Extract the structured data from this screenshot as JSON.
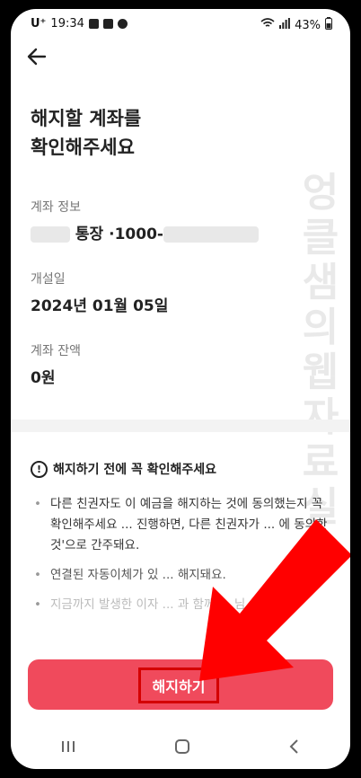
{
  "status_bar": {
    "carrier": "U⁺",
    "time": "19:34",
    "battery": "43%"
  },
  "header": {
    "back_icon": "arrow-left-icon"
  },
  "page": {
    "title_line1": "해지할 계좌를",
    "title_line2": "확인해주세요"
  },
  "account": {
    "info_label": "계좌 정보",
    "account_type": "통장",
    "account_number_prefix": "·1000-",
    "opened_label": "개설일",
    "opened_value": "2024년 01월 05일",
    "balance_label": "계좌 잔액",
    "balance_value": "0원"
  },
  "notice": {
    "title": "해지하기 전에 꼭 확인해주세요",
    "items": [
      "다른 친권자도 이 예금을 해지하는 것에 동의했는지 꼭 확인해주세요 ... 진행하면, 다른 친권자가 ... 에 동의한 것'으로 간주돼요.",
      "연결된 자동이체가 있 ... 해지돼요.",
      "지금까지 발생한 이자 ... 과 함께 ... 님"
    ]
  },
  "cta": {
    "label": "해지하기"
  },
  "watermark": "엉클샘의웹자료실",
  "colors": {
    "accent": "#f04a5c",
    "highlight": "#d40000"
  }
}
